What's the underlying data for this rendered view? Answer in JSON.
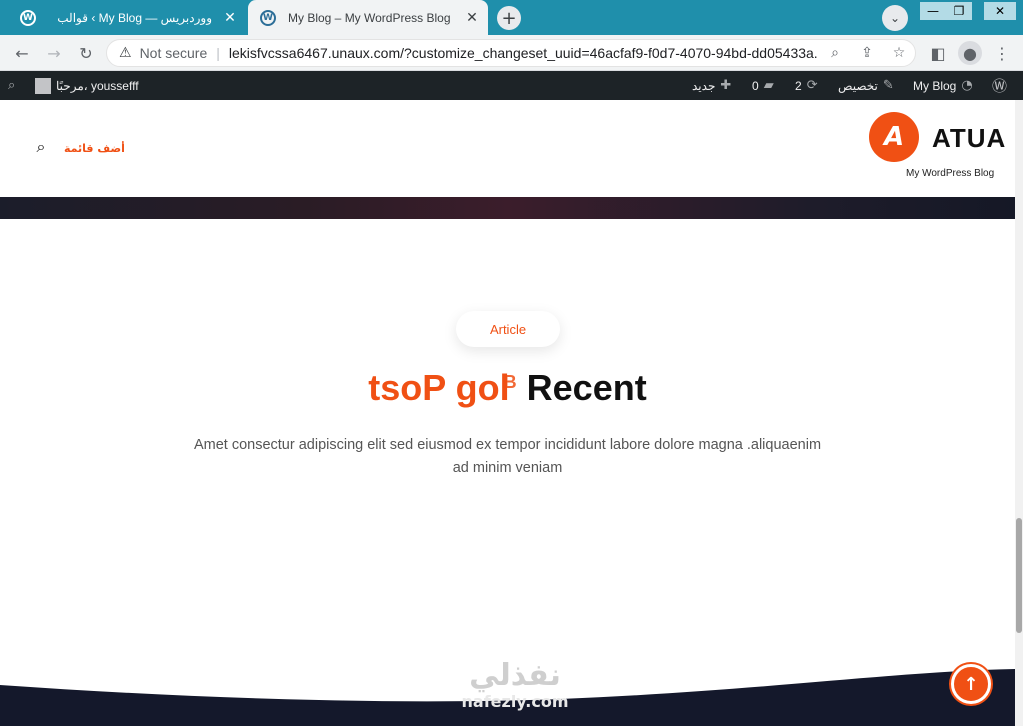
{
  "browser": {
    "tabs": [
      {
        "title": "قوالب ‹ My Blog — ووردبريس",
        "active": false
      },
      {
        "title": "My Blog – My WordPress Blog",
        "active": true
      }
    ],
    "address": {
      "security_label": "Not secure",
      "url": "lekisfvcssa6467.unaux.com/?customize_changeset_uuid=46acfaf9-f0d7-4070-94bd-dd05433a..."
    }
  },
  "adminbar": {
    "site_name": "My Blog",
    "customize": "تخصيص",
    "updates_count": "2",
    "comments_count": "0",
    "new_label": "جديد",
    "greeting": "مرحبًا، youssefff"
  },
  "header": {
    "logo_letter": "A",
    "logo_text": "ATUA",
    "tagline": "My WordPress Blog",
    "add_menu": "أضف قائمة"
  },
  "section": {
    "pill_label": "Article",
    "heading_orange": "tsoP gol",
    "heading_small": "B",
    "heading_dark": "Recent",
    "paragraph": "Amet consectur adipiscing elit sed eiusmod ex tempor incididunt labore dolore magna .aliquaenim ad minim veniam"
  },
  "watermark": {
    "line1": "نفذلي",
    "line2": "nafezly.com"
  },
  "colors": {
    "accent": "#f05014",
    "admin_bar": "#1d2327",
    "tabstrip": "#1f8fab",
    "footer": "#14182b"
  }
}
